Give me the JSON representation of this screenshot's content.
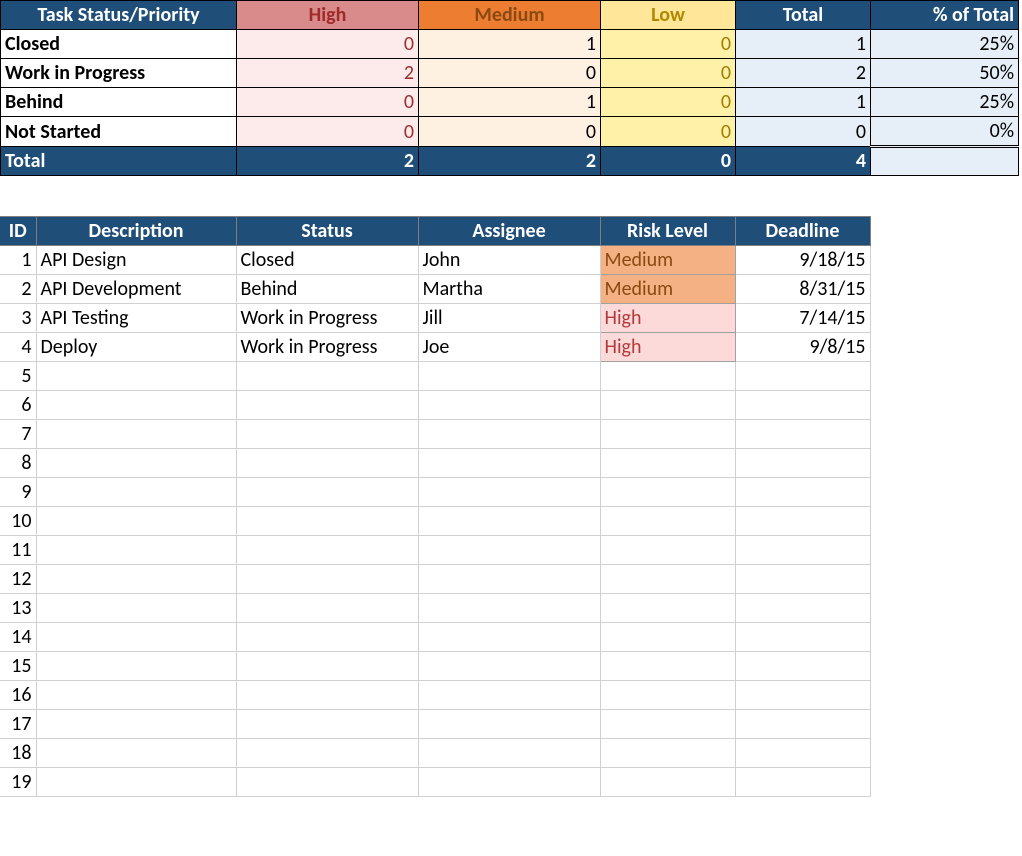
{
  "summary": {
    "headers": {
      "status_priority": "Task Status/Priority",
      "high": "High",
      "medium": "Medium",
      "low": "Low",
      "total": "Total",
      "pct": "% of Total"
    },
    "rows": [
      {
        "label": "Closed",
        "high": "0",
        "medium": "1",
        "low": "0",
        "total": "1",
        "pct": "25%"
      },
      {
        "label": "Work in Progress",
        "high": "2",
        "medium": "0",
        "low": "0",
        "total": "2",
        "pct": "50%"
      },
      {
        "label": "Behind",
        "high": "0",
        "medium": "1",
        "low": "0",
        "total": "1",
        "pct": "25%"
      },
      {
        "label": "Not Started",
        "high": "0",
        "medium": "0",
        "low": "0",
        "total": "0",
        "pct": "0%"
      }
    ],
    "totals": {
      "label": "Total",
      "high": "2",
      "medium": "2",
      "low": "0",
      "total": "4",
      "pct": ""
    }
  },
  "detail": {
    "headers": {
      "id": "ID",
      "description": "Description",
      "status": "Status",
      "assignee": "Assignee",
      "risk": "Risk Level",
      "deadline": "Deadline"
    },
    "rows": [
      {
        "id": "1",
        "description": "API Design",
        "status": "Closed",
        "assignee": "John",
        "risk": "Medium",
        "deadline": "9/18/15"
      },
      {
        "id": "2",
        "description": "API Development",
        "status": "Behind",
        "assignee": "Martha",
        "risk": "Medium",
        "deadline": "8/31/15"
      },
      {
        "id": "3",
        "description": "API Testing",
        "status": "Work in Progress",
        "assignee": "Jill",
        "risk": "High",
        "deadline": "7/14/15"
      },
      {
        "id": "4",
        "description": "Deploy",
        "status": "Work in Progress",
        "assignee": "Joe",
        "risk": "High",
        "deadline": "9/8/15"
      }
    ],
    "empty_ids": [
      "5",
      "6",
      "7",
      "8",
      "9",
      "10",
      "11",
      "12",
      "13",
      "14",
      "15",
      "16",
      "17",
      "18",
      "19"
    ]
  }
}
